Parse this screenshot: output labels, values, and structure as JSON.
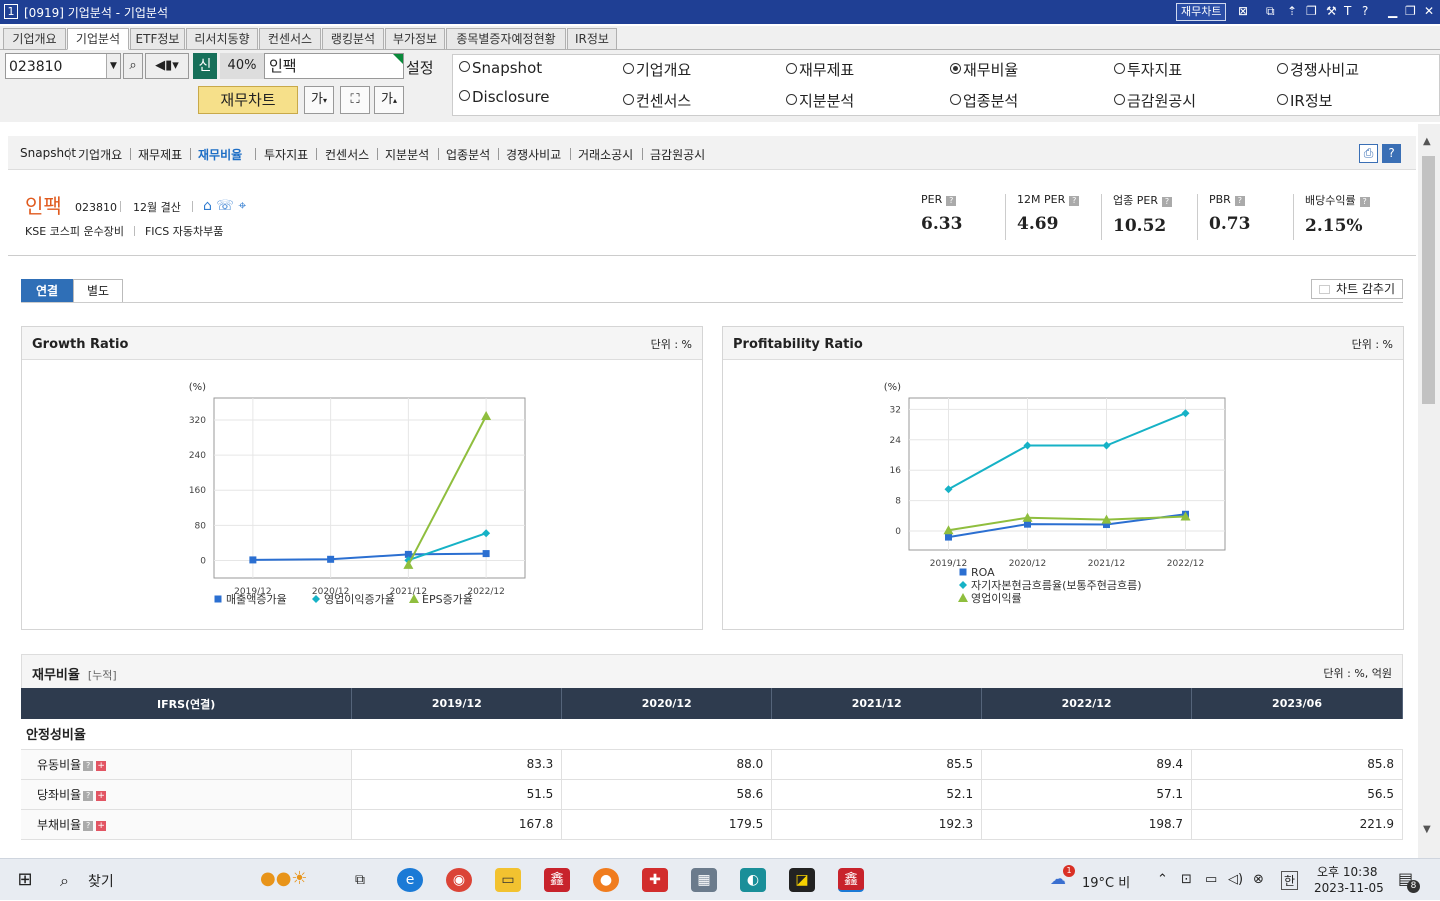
{
  "window": {
    "number": "1",
    "title": "[0919] 기업분석 - 기업분석",
    "fin_chart_btn": "재무차트"
  },
  "menu_tabs": [
    "기업개요",
    "기업분석",
    "ETF정보",
    "리서치동향",
    "컨센서스",
    "랭킹분석",
    "부가정보",
    "종목별증자예정현황",
    "IR정보"
  ],
  "toolbar": {
    "code": "023810",
    "sin": "신",
    "pct": "40%",
    "name": "인팩",
    "setup": "설정",
    "fin_chart": "재무차트",
    "ga_small": "가",
    "ga_big": "가"
  },
  "radios": [
    {
      "label": "Snapshot",
      "checked": false
    },
    {
      "label": "기업개요",
      "checked": false
    },
    {
      "label": "재무제표",
      "checked": false
    },
    {
      "label": "재무비율",
      "checked": true
    },
    {
      "label": "투자지표",
      "checked": false
    },
    {
      "label": "경쟁사비교",
      "checked": false
    },
    {
      "label": "Disclosure",
      "checked": false
    },
    {
      "label": "컨센서스",
      "checked": false
    },
    {
      "label": "지분분석",
      "checked": false
    },
    {
      "label": "업종분석",
      "checked": false
    },
    {
      "label": "금감원공시",
      "checked": false
    },
    {
      "label": "IR정보",
      "checked": false
    }
  ],
  "subnav": [
    "Snapshot",
    "기업개요",
    "재무제표",
    "재무비율",
    "투자지표",
    "컨센서스",
    "지분분석",
    "업종분석",
    "경쟁사비교",
    "거래소공시",
    "금감원공시"
  ],
  "company": {
    "name": "인팩",
    "code": "023810",
    "settlement": "12월 결산",
    "market": "KSE  코스피 운수장비",
    "fics": "FICS 자동차부품"
  },
  "metrics": [
    {
      "label": "PER",
      "value": "6.33"
    },
    {
      "label": "12M PER",
      "value": "4.69"
    },
    {
      "label": "업종 PER",
      "value": "10.52"
    },
    {
      "label": "PBR",
      "value": "0.73"
    },
    {
      "label": "배당수익률",
      "value": "2.15%"
    }
  ],
  "tabs": {
    "consolidated": "연결",
    "separate": "별도",
    "hide_chart": "차트 감추기"
  },
  "chart_data": [
    {
      "type": "line",
      "title": "Growth Ratio",
      "unit": "단위 : %",
      "ylabel": "(%)",
      "categories": [
        "2019/12",
        "2020/12",
        "2021/12",
        "2022/12"
      ],
      "yticks": [
        0,
        80,
        160,
        240,
        320
      ],
      "ylim": [
        -40,
        370
      ],
      "series": [
        {
          "name": "매출액증가율",
          "color": "#2b6fd1",
          "marker": "square",
          "values": [
            1.2,
            2.6,
            13.8,
            15.6
          ]
        },
        {
          "name": "영업이익증가율",
          "color": "#16b2c6",
          "marker": "diamond",
          "values": [
            null,
            null,
            0.5,
            62
          ]
        },
        {
          "name": "EPS증가율",
          "color": "#8fbe3e",
          "marker": "triangle",
          "values": [
            null,
            null,
            -10,
            329
          ]
        }
      ]
    },
    {
      "type": "line",
      "title": "Profitability Ratio",
      "unit": "단위 : %",
      "ylabel": "(%)",
      "categories": [
        "2019/12",
        "2020/12",
        "2021/12",
        "2022/12"
      ],
      "yticks": [
        0,
        8,
        16,
        24,
        32
      ],
      "ylim": [
        -5,
        35
      ],
      "series": [
        {
          "name": "ROA",
          "color": "#2b6fd1",
          "marker": "square",
          "values": [
            -1.6,
            1.8,
            1.7,
            4.4
          ]
        },
        {
          "name": "자기자본현금흐름율(보통주현금흐름)",
          "color": "#16b2c6",
          "marker": "diamond",
          "values": [
            11,
            22.5,
            22.5,
            31
          ]
        },
        {
          "name": "영업이익률",
          "color": "#8fbe3e",
          "marker": "triangle",
          "values": [
            0.2,
            3.5,
            3.0,
            3.8
          ]
        }
      ]
    }
  ],
  "ratio_table": {
    "title": "재무비율",
    "subtitle": "[누적]",
    "unit": "단위 : %, 억원",
    "header": [
      "IFRS(연결)",
      "2019/12",
      "2020/12",
      "2021/12",
      "2022/12",
      "2023/06"
    ],
    "group": "안정성비율",
    "rows": [
      {
        "label": "유동비율",
        "values": [
          "83.3",
          "88.0",
          "85.5",
          "89.4",
          "85.8"
        ]
      },
      {
        "label": "당좌비율",
        "values": [
          "51.5",
          "58.6",
          "52.1",
          "57.1",
          "56.5"
        ]
      },
      {
        "label": "부채비율",
        "values": [
          "167.8",
          "179.5",
          "192.3",
          "198.7",
          "221.9"
        ]
      }
    ]
  },
  "taskbar": {
    "search": "찾기",
    "weather": "19°C  비",
    "lang": "한",
    "time": "오후 10:38",
    "date": "2023-11-05",
    "notif": "8",
    "weather_badge": "1"
  }
}
